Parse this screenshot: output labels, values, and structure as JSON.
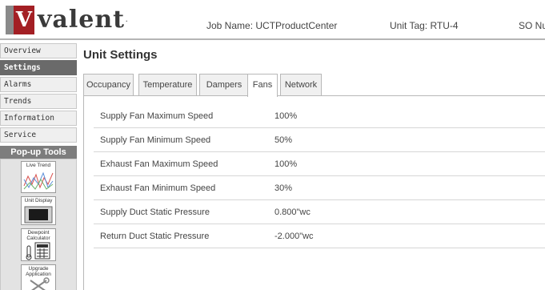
{
  "header": {
    "logo_letter": "V",
    "logo_text": "valent",
    "logo_mark": ".",
    "job_name": "Job Name: UCTProductCenter",
    "unit_tag": "Unit Tag: RTU-4",
    "so_number": "SO Nu"
  },
  "sidebar": {
    "items": [
      {
        "label": "Overview"
      },
      {
        "label": "Settings"
      },
      {
        "label": "Alarms"
      },
      {
        "label": "Trends"
      },
      {
        "label": "Information"
      },
      {
        "label": "Service"
      }
    ],
    "active_index": 1,
    "popup_title": "Pop-up Tools",
    "tools": [
      {
        "label": "Live Trend"
      },
      {
        "label": "Unit Display"
      },
      {
        "label": "Dewpoint Calculator"
      },
      {
        "label": "Upgrade Application"
      }
    ]
  },
  "main": {
    "title": "Unit Settings",
    "tabs": [
      {
        "label": "Occupancy"
      },
      {
        "label": "Temperature"
      },
      {
        "label": "Dampers"
      },
      {
        "label": "Fans"
      },
      {
        "label": "Network"
      }
    ],
    "active_tab": "Fans",
    "rows": [
      {
        "label": "Supply Fan Maximum Speed",
        "value": "100%"
      },
      {
        "label": "Supply Fan Minimum Speed",
        "value": "50%"
      },
      {
        "label": "Exhaust Fan Maximum Speed",
        "value": "100%"
      },
      {
        "label": "Exhaust Fan Minimum Speed",
        "value": "30%"
      },
      {
        "label": "Supply Duct Static Pressure",
        "value": "0.800\"wc"
      },
      {
        "label": "Return Duct Static Pressure",
        "value": "-2.000\"wc"
      }
    ]
  },
  "colors": {
    "brand_red": "#a31f24",
    "nav_active": "#6a6a6a",
    "popup_header": "#7d7d7d"
  }
}
